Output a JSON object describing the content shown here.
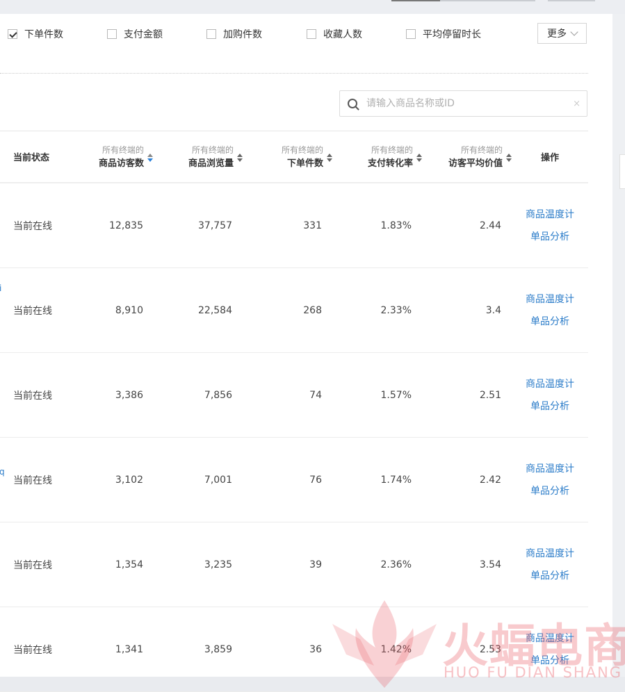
{
  "metrics": {
    "options": [
      {
        "label": "下单件数",
        "checked": true
      },
      {
        "label": "支付金额",
        "checked": false
      },
      {
        "label": "加购件数",
        "checked": false
      },
      {
        "label": "收藏人数",
        "checked": false
      },
      {
        "label": "平均停留时长",
        "checked": false
      }
    ],
    "more_label": "更多"
  },
  "search": {
    "placeholder": "请输入商品名称或ID",
    "clear_glyph": "×",
    "icon": "search-icon"
  },
  "table": {
    "headers": {
      "status": "当前状态",
      "visitors": {
        "top": "所有终端的",
        "bottom": "商品访客数"
      },
      "views": {
        "top": "所有终端的",
        "bottom": "商品浏览量"
      },
      "orders": {
        "top": "所有终端的",
        "bottom": "下单件数"
      },
      "conversion": {
        "top": "所有终端的",
        "bottom": "支付转化率"
      },
      "avg_value": {
        "top": "所有终端的",
        "bottom": "访客平均价值"
      },
      "actions": "操作"
    },
    "rows": [
      {
        "status": "当前在线",
        "visitors": "12,835",
        "views": "37,757",
        "orders": "331",
        "conversion": "1.83%",
        "avg_value": "2.44",
        "action1": "商品温度计",
        "action2": "单品分析"
      },
      {
        "status": "当前在线",
        "visitors": "8,910",
        "views": "22,584",
        "orders": "268",
        "conversion": "2.33%",
        "avg_value": "3.4",
        "action1": "商品温度计",
        "action2": "单品分析"
      },
      {
        "status": "当前在线",
        "visitors": "3,386",
        "views": "7,856",
        "orders": "74",
        "conversion": "1.57%",
        "avg_value": "2.51",
        "action1": "商品温度计",
        "action2": "单品分析"
      },
      {
        "status": "当前在线",
        "visitors": "3,102",
        "views": "7,001",
        "orders": "76",
        "conversion": "1.74%",
        "avg_value": "2.42",
        "action1": "商品温度计",
        "action2": "单品分析"
      },
      {
        "status": "当前在线",
        "visitors": "1,354",
        "views": "3,235",
        "orders": "39",
        "conversion": "2.36%",
        "avg_value": "3.54",
        "action1": "商品温度计",
        "action2": "单品分析"
      },
      {
        "status": "当前在线",
        "visitors": "1,341",
        "views": "3,859",
        "orders": "36",
        "conversion": "1.42%",
        "avg_value": "2.53",
        "action1": "商品温度计",
        "action2": "单品分析"
      }
    ],
    "edge_glyphs": [
      "i",
      "q"
    ]
  },
  "watermark": {
    "title": "火蝠电商",
    "subtitle": "HUO FU DIAN SHANG"
  },
  "colors": {
    "link": "#2b7cc9",
    "sort_active": "#2b82d9",
    "watermark": "#e95a64"
  }
}
